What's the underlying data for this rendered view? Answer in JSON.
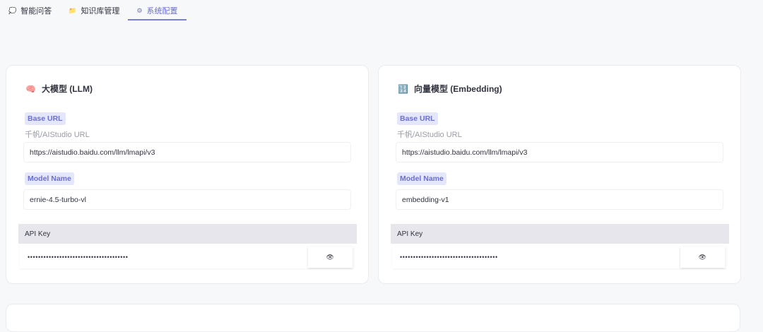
{
  "tabs": [
    {
      "label": "智能问答",
      "icon": "chat-icon"
    },
    {
      "label": "知识库管理",
      "icon": "folder-icon"
    },
    {
      "label": "系统配置",
      "icon": "gear-icon",
      "active": true
    }
  ],
  "llm": {
    "title": "大模型 (LLM)",
    "icon": "brain-icon",
    "base_url_label": "Base URL",
    "base_url_hint": "千帆/AIStudio URL",
    "base_url": "https://aistudio.baidu.com/llm/lmapi/v3",
    "model_label": "Model Name",
    "model": "ernie-4.5-turbo-vl",
    "api_key_label": "API Key",
    "api_key": "••••••••••••••••••••••••••••••••••••••"
  },
  "embedding": {
    "title": "向量模型 (Embedding)",
    "icon": "numbers-icon",
    "base_url_label": "Base URL",
    "base_url_hint": "千帆/AIStudio URL",
    "base_url": "https://aistudio.baidu.com/llm/lmapi/v3",
    "model_label": "Model Name",
    "model": "embedding-v1",
    "api_key_label": "API Key",
    "api_key": "•••••••••••••••••••••••••••••••••••••"
  },
  "colors": {
    "accent": "#6b6fd0",
    "badge_bg": "#e4e6fb"
  }
}
